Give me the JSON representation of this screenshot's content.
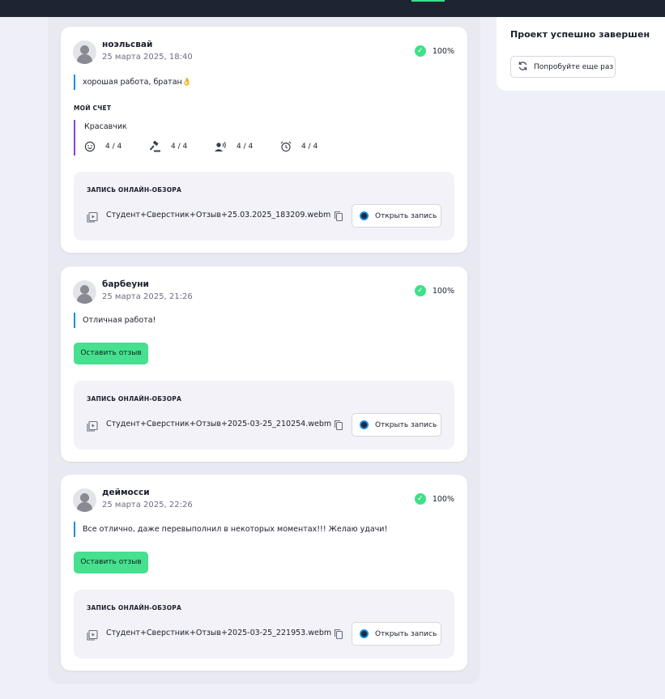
{
  "side": {
    "title": "Проект успешно завершен",
    "retry_label": "Попробуйте еще раз"
  },
  "reviews": [
    {
      "username": "ноэльсвай",
      "date": "25 марта 2025, 18:40",
      "score": "100%",
      "comment": "хорошая работа, братан👌",
      "my_score_label": "МОЙ СЧЕТ",
      "score_title": "Красавчик",
      "criteria": [
        {
          "icon": "smile-icon",
          "value": "4 / 4"
        },
        {
          "icon": "gavel-icon",
          "value": "4 / 4"
        },
        {
          "icon": "speaking-person-icon",
          "value": "4 / 4"
        },
        {
          "icon": "alarm-clock-icon",
          "value": "4 / 4"
        }
      ],
      "recording_title": "ЗАПИСЬ ОНЛАЙН-ОБЗОРА",
      "file_name": "Студент+Сверстник+Отзыв+25.03.2025_183209.webm",
      "open_label": "Открыть запись"
    },
    {
      "username": "барбеуни",
      "date": "25 марта 2025, 21:26",
      "score": "100%",
      "comment": "Отличная работа!",
      "feedback_label": "Оставить отзыв",
      "recording_title": "ЗАПИСЬ ОНЛАЙН-ОБЗОРА",
      "file_name": "Студент+Сверстник+Отзыв+2025-03-25_210254.webm",
      "open_label": "Открыть запись"
    },
    {
      "username": "деймосси",
      "date": "25 марта 2025, 22:26",
      "score": "100%",
      "comment": "Все отлично, даже перевыполнил в некоторых моментах!!! Желаю удачи!",
      "feedback_label": "Оставить отзыв",
      "recording_title": "ЗАПИСЬ ОНЛАЙН-ОБЗОРА",
      "file_name": "Студент+Сверстник+Отзыв+2025-03-25_221953.webm",
      "open_label": "Открыть запись"
    }
  ],
  "colors": {
    "accent_green": "#46e08f",
    "comment_bar": "#1a8fd8",
    "score_bar": "#8a3fe0",
    "topbar": "#1d2432"
  }
}
